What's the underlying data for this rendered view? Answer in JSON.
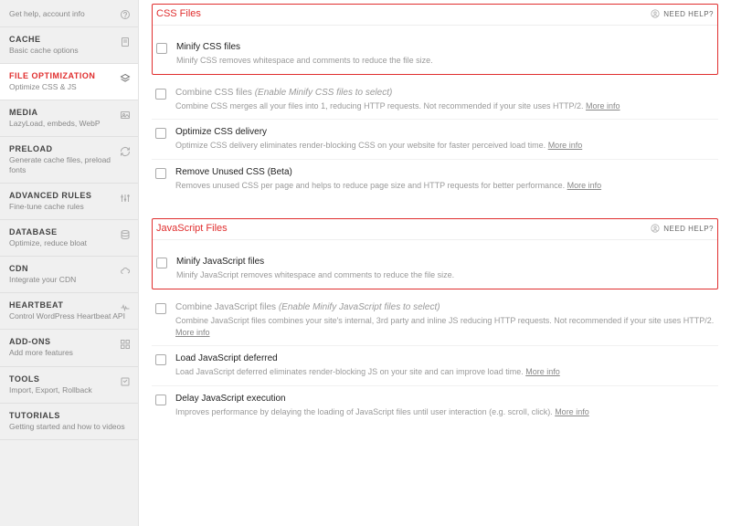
{
  "sidebar": [
    {
      "title": "",
      "sub": "Get help, account info",
      "icon": "help"
    },
    {
      "title": "CACHE",
      "sub": "Basic cache options",
      "icon": "cache"
    },
    {
      "title": "FILE OPTIMIZATION",
      "sub": "Optimize CSS & JS",
      "icon": "layers",
      "active": true
    },
    {
      "title": "MEDIA",
      "sub": "LazyLoad, embeds, WebP",
      "icon": "media"
    },
    {
      "title": "PRELOAD",
      "sub": "Generate cache files, preload fonts",
      "icon": "refresh"
    },
    {
      "title": "ADVANCED RULES",
      "sub": "Fine-tune cache rules",
      "icon": "sliders"
    },
    {
      "title": "DATABASE",
      "sub": "Optimize, reduce bloat",
      "icon": "database"
    },
    {
      "title": "CDN",
      "sub": "Integrate your CDN",
      "icon": "cloud"
    },
    {
      "title": "HEARTBEAT",
      "sub": "Control WordPress Heartbeat API",
      "icon": "heart"
    },
    {
      "title": "ADD-ONS",
      "sub": "Add more features",
      "icon": "addons"
    },
    {
      "title": "TOOLS",
      "sub": "Import, Export, Rollback",
      "icon": "tools"
    },
    {
      "title": "TUTORIALS",
      "sub": "Getting started and how to videos",
      "icon": ""
    }
  ],
  "need_help": "NEED HELP?",
  "more_info": "More info",
  "sections": [
    {
      "title": "CSS Files",
      "highlight_indices": [
        0
      ],
      "options": [
        {
          "title": "Minify CSS files",
          "desc": "Minify CSS removes whitespace and comments to reduce the file size."
        },
        {
          "title": "Combine CSS files",
          "suffix": "(Enable Minify CSS files to select)",
          "desc": "Combine CSS merges all your files into 1, reducing HTTP requests. Not recommended if your site uses HTTP/2.",
          "more": true,
          "dim": true
        },
        {
          "title": "Optimize CSS delivery",
          "desc": "Optimize CSS delivery eliminates render-blocking CSS on your website for faster perceived load time.",
          "more": true
        },
        {
          "title": "Remove Unused CSS (Beta)",
          "desc": "Removes unused CSS per page and helps to reduce page size and HTTP requests for better performance.",
          "more": true
        }
      ]
    },
    {
      "title": "JavaScript Files",
      "highlight_indices": [
        0
      ],
      "options": [
        {
          "title": "Minify JavaScript files",
          "desc": "Minify JavaScript removes whitespace and comments to reduce the file size."
        },
        {
          "title": "Combine JavaScript files",
          "suffix": "(Enable Minify JavaScript files to select)",
          "desc": "Combine JavaScript files combines your site's internal, 3rd party and inline JS reducing HTTP requests. Not recommended if your site uses HTTP/2.",
          "more": true,
          "dim": true
        },
        {
          "title": "Load JavaScript deferred",
          "desc": "Load JavaScript deferred eliminates render-blocking JS on your site and can improve load time.",
          "more": true
        },
        {
          "title": "Delay JavaScript execution",
          "desc": "Improves performance by delaying the loading of JavaScript files until user interaction (e.g. scroll, click).",
          "more": true
        }
      ]
    }
  ]
}
